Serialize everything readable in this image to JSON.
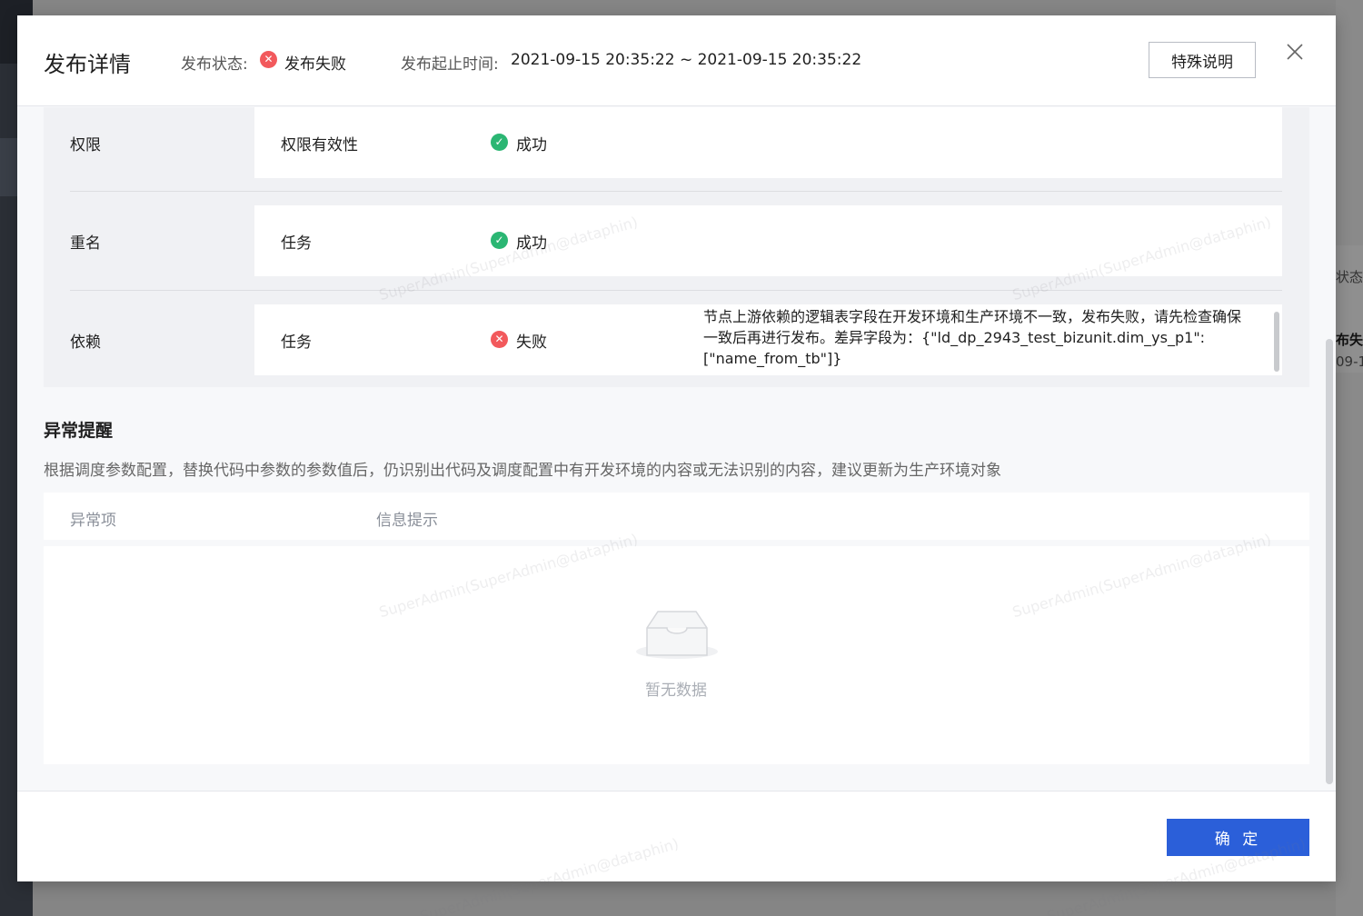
{
  "background": {
    "right_texts": [
      "状态/",
      "布失",
      "09-1"
    ]
  },
  "header": {
    "title": "发布详情",
    "status_label": "发布状态:",
    "status_value": "发布失败",
    "time_label": "发布起止时间:",
    "time_value": "2021-09-15 20:35:22 ~ 2021-09-15 20:35:22",
    "special_button": "特殊说明",
    "close_icon": "close-icon"
  },
  "checks": [
    {
      "category": "权限",
      "item": "权限有效性",
      "result": "成功",
      "status": "success",
      "message": ""
    },
    {
      "category": "重名",
      "item": "任务",
      "result": "成功",
      "status": "success",
      "message": ""
    },
    {
      "category": "依赖",
      "item": "任务",
      "result": "失败",
      "status": "fail",
      "message": "节点上游依赖的逻辑表字段在开发环境和生产环境不一致，发布失败，请先检查确保一致后再进行发布。差异字段为：{\"ld_dp_2943_test_bizunit.dim_ys_p1\":[\"name_from_tb\"]}"
    }
  ],
  "anomaly": {
    "title": "异常提醒",
    "description": "根据调度参数配置，替换代码中参数的参数值后，仍识别出代码及调度配置中有开发环境的内容或无法识别的内容，建议更新为生产环境对象",
    "columns": [
      "异常项",
      "信息提示"
    ],
    "empty_text": "暂无数据"
  },
  "footer": {
    "confirm_label": "确 定"
  },
  "watermark": "SuperAdmin(SuperAdmin@dataphin)",
  "colors": {
    "primary": "#2b5fd9",
    "success": "#2bb673",
    "fail": "#f2595c"
  }
}
